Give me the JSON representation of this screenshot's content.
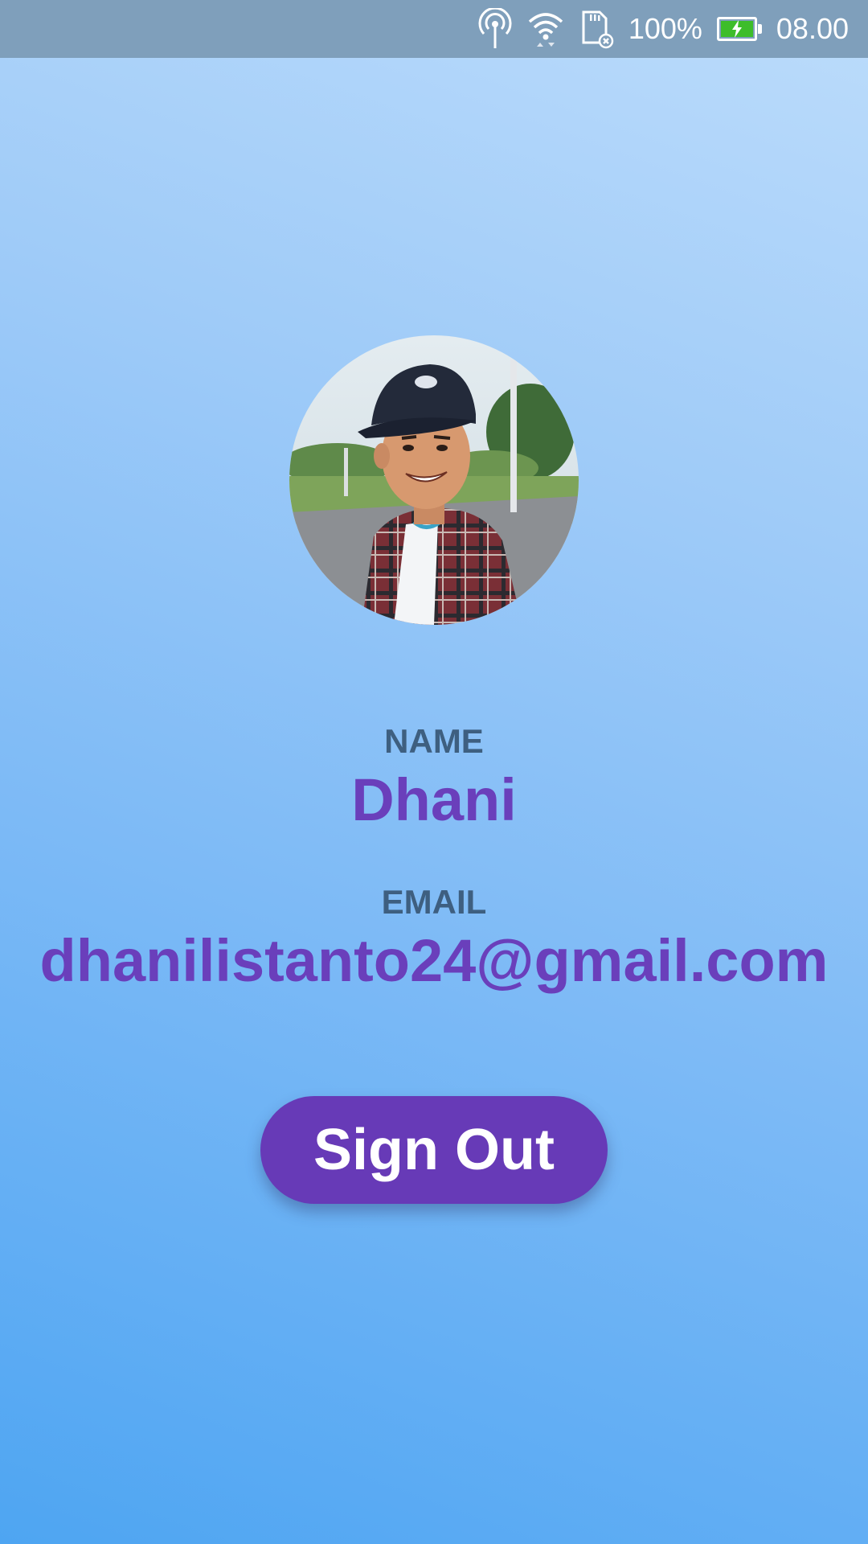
{
  "status_bar": {
    "icons": [
      "hotspot-icon",
      "wifi-icon",
      "sd-card-icon",
      "battery-icon"
    ],
    "battery_percent": "100%",
    "battery_level": 1.0,
    "time": "08.00",
    "battery_color": "#3dbd2a"
  },
  "profile": {
    "avatar": "profile-photo",
    "name_label": "NAME",
    "name": "Dhani",
    "email_label": "EMAIL",
    "email": "dhanilistanto24@gmail.com"
  },
  "actions": {
    "sign_out_label": "Sign Out"
  },
  "colors": {
    "accent": "#673ab7",
    "value_text": "#6a3fbb",
    "label_text": "#3e5f80"
  }
}
